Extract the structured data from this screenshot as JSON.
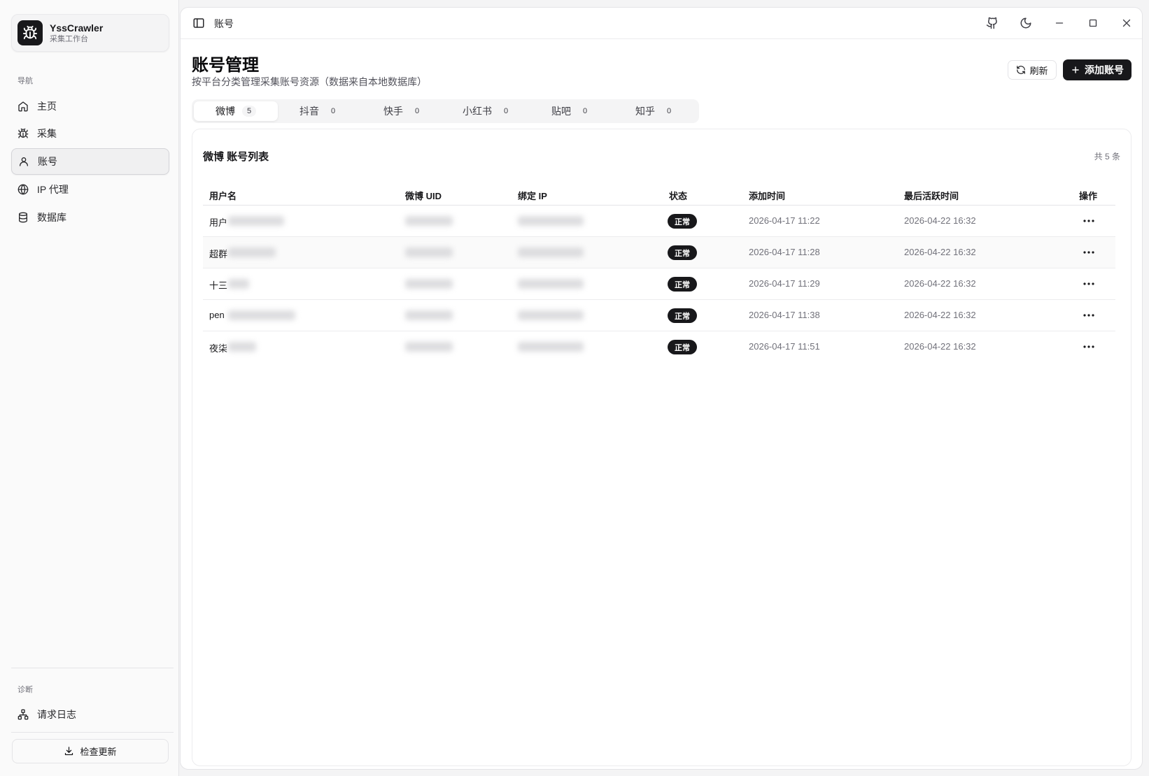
{
  "app": {
    "name": "YssCrawler",
    "subtitle": "采集工作台"
  },
  "sidebar": {
    "nav_label": "导航",
    "items": [
      {
        "label": "主页",
        "icon": "home-icon"
      },
      {
        "label": "采集",
        "icon": "bug-icon"
      },
      {
        "label": "账号",
        "icon": "user-icon",
        "active": true
      },
      {
        "label": "IP 代理",
        "icon": "globe-icon"
      },
      {
        "label": "数据库",
        "icon": "database-icon"
      }
    ],
    "diag_label": "诊断",
    "diag_items": [
      {
        "label": "请求日志",
        "icon": "network-icon"
      }
    ],
    "update_label": "检查更新"
  },
  "topbar": {
    "breadcrumb": "账号"
  },
  "page": {
    "title": "账号管理",
    "subtitle": "按平台分类管理采集账号资源（数据来自本地数据库）",
    "refresh_label": "刷新",
    "add_label": "添加账号"
  },
  "tabs": [
    {
      "label": "微博",
      "count": "5",
      "active": true
    },
    {
      "label": "抖音",
      "count": "0"
    },
    {
      "label": "快手",
      "count": "0"
    },
    {
      "label": "小红书",
      "count": "0"
    },
    {
      "label": "贴吧",
      "count": "0"
    },
    {
      "label": "知乎",
      "count": "0"
    }
  ],
  "table": {
    "title": "微博 账号列表",
    "total": "共 5 条",
    "columns": [
      "用户名",
      "微博 UID",
      "绑定 IP",
      "状态",
      "添加时间",
      "最后活跃时间",
      "操作"
    ],
    "rows": [
      {
        "username": "用户",
        "status": "正常",
        "added": "2026-04-17 11:22",
        "last_active": "2026-04-22 16:32"
      },
      {
        "username": "超群",
        "status": "正常",
        "added": "2026-04-17 11:28",
        "last_active": "2026-04-22 16:32"
      },
      {
        "username": "十三",
        "status": "正常",
        "added": "2026-04-17 11:29",
        "last_active": "2026-04-22 16:32"
      },
      {
        "username": "pen",
        "status": "正常",
        "added": "2026-04-17 11:38",
        "last_active": "2026-04-22 16:32"
      },
      {
        "username": "夜柒",
        "status": "正常",
        "added": "2026-04-17 11:51",
        "last_active": "2026-04-22 16:32"
      }
    ]
  }
}
